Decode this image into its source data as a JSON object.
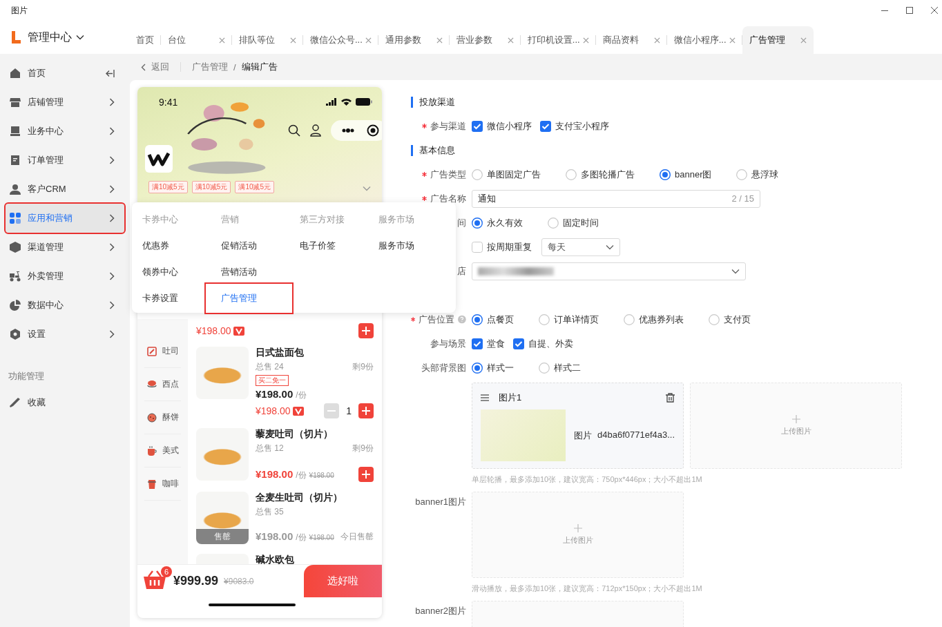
{
  "window": {
    "title": "图片"
  },
  "header": {
    "brand": "管理中心",
    "tabs": [
      {
        "label": "首页",
        "closable": false,
        "selected": false
      },
      {
        "label": "台位",
        "closable": true,
        "selected": false
      },
      {
        "label": "排队等位",
        "closable": true,
        "selected": false
      },
      {
        "label": "微信公众号...",
        "closable": true,
        "selected": false
      },
      {
        "label": "通用参数",
        "closable": true,
        "selected": false
      },
      {
        "label": "营业参数",
        "closable": true,
        "selected": false
      },
      {
        "label": "打印机设置...",
        "closable": true,
        "selected": false
      },
      {
        "label": "商品资料",
        "closable": true,
        "selected": false
      },
      {
        "label": "微信小程序...",
        "closable": true,
        "selected": false
      },
      {
        "label": "广告管理",
        "closable": true,
        "selected": true
      }
    ]
  },
  "sidebar": {
    "items": [
      {
        "label": "首页",
        "selected": false,
        "highlighted": false
      },
      {
        "label": "店铺管理",
        "selected": false,
        "highlighted": false
      },
      {
        "label": "业务中心",
        "selected": false,
        "highlighted": false
      },
      {
        "label": "订单管理",
        "selected": false,
        "highlighted": false
      },
      {
        "label": "客户CRM",
        "selected": false,
        "highlighted": false
      },
      {
        "label": "应用和营销",
        "selected": true,
        "highlighted": true
      },
      {
        "label": "渠道管理",
        "selected": false,
        "highlighted": false
      },
      {
        "label": "外卖管理",
        "selected": false,
        "highlighted": false
      },
      {
        "label": "数据中心",
        "selected": false,
        "highlighted": false
      },
      {
        "label": "设置",
        "selected": false,
        "highlighted": false
      }
    ],
    "section_title": "功能管理",
    "favorites": [
      {
        "label": "收藏"
      }
    ]
  },
  "breadcrumb": {
    "back": "返回",
    "items": [
      "广告管理",
      "编辑广告"
    ],
    "separator": "/"
  },
  "phone_preview": {
    "time": "9:41",
    "coupons": [
      "满10减5元",
      "满10减5元",
      "满10减5元"
    ],
    "categories": [
      {
        "label": "吐司"
      },
      {
        "label": "西点"
      },
      {
        "label": "酥饼"
      },
      {
        "label": "美式"
      },
      {
        "label": "咖啡"
      }
    ],
    "products": [
      {
        "kind": "partial",
        "member_price": "¥198.00"
      },
      {
        "kind": "item",
        "name": "日式盐面包",
        "sales": "总售 24",
        "stock": "剩9份",
        "tag": "买二免一",
        "price": "¥198.00",
        "unit": "/份",
        "member_price": "¥198.00",
        "quantity": "1",
        "sold_out": false
      },
      {
        "kind": "item",
        "name": "藜麦吐司（切片）",
        "sales": "总售 12",
        "stock": "剩9份",
        "price": "¥198.00",
        "unit": "/份",
        "original_price": "¥198.00",
        "sold_out": false
      },
      {
        "kind": "item",
        "name": "全麦生吐司（切片）",
        "sales": "总售 35",
        "price": "¥198.00",
        "unit": "/份",
        "original_price": "¥198.00",
        "sold_out": true,
        "sold_out_label": "售罄",
        "status": "今日售罄"
      },
      {
        "kind": "item",
        "name": "碱水欧包"
      }
    ],
    "cart": {
      "count": "6",
      "total": "¥999.99",
      "original_total": "¥9083.0",
      "checkout": "选好啦"
    }
  },
  "form": {
    "sections": [
      {
        "title": "投放渠道",
        "rows": [
          {
            "kind": "checks",
            "label": "参与渠道",
            "required": true,
            "options": [
              {
                "label": "微信小程序",
                "checked": true
              },
              {
                "label": "支付宝小程序",
                "checked": true
              }
            ]
          }
        ]
      },
      {
        "title": "基本信息",
        "rows": [
          {
            "kind": "radios",
            "label": "广告类型",
            "required": true,
            "options": [
              {
                "label": "单图固定广告",
                "selected": false
              },
              {
                "label": "多图轮播广告",
                "selected": false
              },
              {
                "label": "banner图",
                "selected": true
              },
              {
                "label": "悬浮球",
                "selected": false
              }
            ]
          },
          {
            "kind": "input",
            "label": "广告名称",
            "required": true,
            "value": "通知",
            "counter": "2 / 15"
          },
          {
            "kind": "radios",
            "label": "间",
            "options": [
              {
                "label": "永久有效",
                "selected": true
              },
              {
                "label": "固定时间",
                "selected": false
              }
            ]
          },
          {
            "kind": "repeat",
            "option": {
              "label": "按周期重复",
              "checked": false
            },
            "select": "每天"
          },
          {
            "kind": "select",
            "label": "店"
          },
          {
            "kind": "radios",
            "label": "广告位置",
            "required": true,
            "help": true,
            "options": [
              {
                "label": "点餐页",
                "selected": true
              },
              {
                "label": "订单详情页",
                "selected": false
              },
              {
                "label": "优惠券列表",
                "selected": false
              },
              {
                "label": "支付页",
                "selected": false
              }
            ]
          },
          {
            "kind": "checks",
            "label": "参与场景",
            "options": [
              {
                "label": "堂食",
                "checked": true
              },
              {
                "label": "自提、外卖",
                "checked": true
              }
            ]
          },
          {
            "kind": "radios",
            "label": "头部背景图",
            "options": [
              {
                "label": "样式一",
                "selected": true
              },
              {
                "label": "样式二",
                "selected": false
              }
            ]
          },
          {
            "kind": "images",
            "items": [
              {
                "title": "图片1",
                "caption": "图片",
                "file": "d4ba6f0771ef4a3..."
              }
            ],
            "upload": "上传图片",
            "hint": "单层轮播，最多添加10张，建议宽高：750px*446px；大小不超出1M"
          },
          {
            "kind": "upload",
            "label": "banner1图片",
            "upload": "上传图片",
            "hint": "滑动播放，最多添加10张，建议宽高：712px*150px；大小不超出1M"
          },
          {
            "kind": "upload",
            "label": "banner2图片"
          }
        ]
      }
    ]
  },
  "flyout_menu": {
    "columns": [
      {
        "title": "卡券中心",
        "items": [
          {
            "label": "优惠券",
            "selected": false,
            "highlighted": false
          },
          {
            "label": "领券中心",
            "selected": false,
            "highlighted": false
          },
          {
            "label": "卡券设置",
            "selected": false,
            "highlighted": false
          }
        ]
      },
      {
        "title": "营销",
        "items": [
          {
            "label": "促销活动",
            "selected": false,
            "highlighted": false
          },
          {
            "label": "营销活动",
            "selected": false,
            "highlighted": false
          },
          {
            "label": "广告管理",
            "selected": true,
            "highlighted": true
          }
        ]
      },
      {
        "title": "第三方对接",
        "items": [
          {
            "label": "电子价签",
            "selected": false,
            "highlighted": false
          }
        ]
      },
      {
        "title": "服务市场",
        "items": [
          {
            "label": "服务市场",
            "selected": false,
            "highlighted": false
          }
        ]
      }
    ]
  }
}
